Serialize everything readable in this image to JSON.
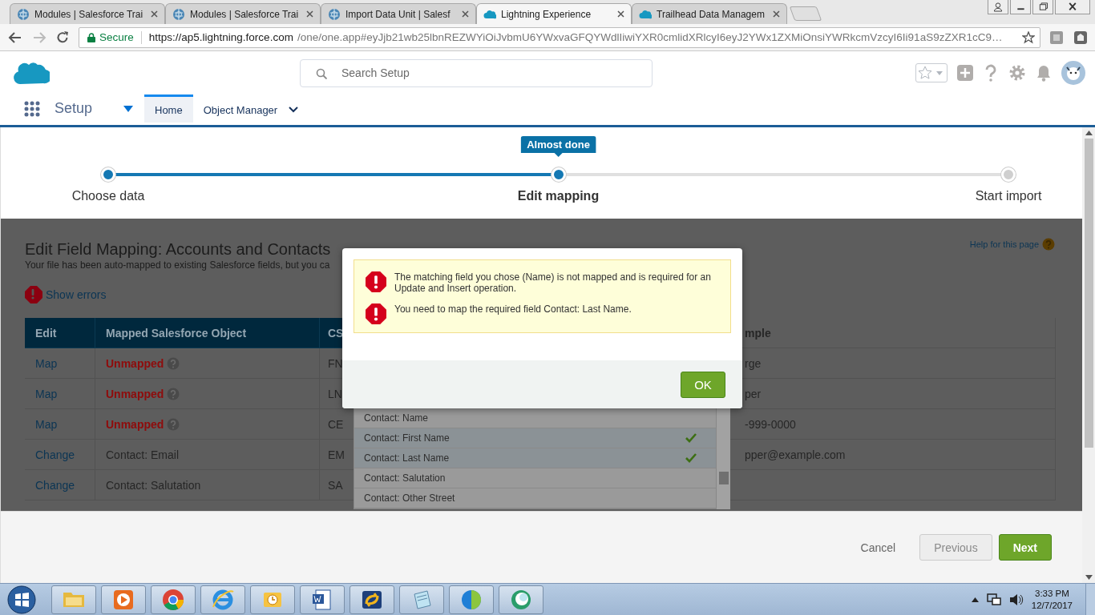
{
  "browser": {
    "tabs": [
      {
        "title": "Modules | Salesforce Trai",
        "kind": "globe",
        "selected": false
      },
      {
        "title": "Modules | Salesforce Trai",
        "kind": "globe",
        "selected": false
      },
      {
        "title": "Import Data Unit | Salesf",
        "kind": "globe",
        "selected": false
      },
      {
        "title": "Lightning Experience",
        "kind": "cloud",
        "selected": true
      },
      {
        "title": "Trailhead Data Managem",
        "kind": "cloud",
        "selected": false
      }
    ],
    "secure_label": "Secure",
    "url_host": "https://ap5.lightning.force.com",
    "url_path": "/one/one.app#eyJjb21wb25lbnREZWYiOiJvbmU6YWxvaGFQYWdlIiwiYXR0cmlidXRlcyI6eyJ2YWx1ZXMiOnsiYWRkcmVzcyI6Ii91aS9zZXR1cC9…"
  },
  "header": {
    "search_placeholder": "Search Setup"
  },
  "nav": {
    "app_name": "Setup",
    "tabs": [
      {
        "label": "Home",
        "selected": true,
        "has_menu": false
      },
      {
        "label": "Object Manager",
        "selected": false,
        "has_menu": true
      }
    ]
  },
  "progress": {
    "level": 0.5,
    "badge": "Almost done",
    "steps": [
      {
        "label": "Choose data",
        "selected": false
      },
      {
        "label": "Edit mapping",
        "selected": true
      },
      {
        "label": "Start import",
        "selected": false
      }
    ]
  },
  "mapping": {
    "title": "Edit Field Mapping: Accounts and Contacts",
    "subtitle": "Your file has been auto-mapped to existing Salesforce fields, but you ca",
    "help_link": "Help for this page",
    "show_errors": "Show errors",
    "columns": [
      "Edit",
      "Mapped Salesforce Object",
      "CS",
      "mple"
    ],
    "rows": [
      {
        "action": "Map",
        "mapped": "Unmapped",
        "unmapped": true,
        "csv": "FN",
        "example": "rge"
      },
      {
        "action": "Map",
        "mapped": "Unmapped",
        "unmapped": true,
        "csv": "LN",
        "example": "per"
      },
      {
        "action": "Map",
        "mapped": "Unmapped",
        "unmapped": true,
        "csv": "CE",
        "example": "-999-0000"
      },
      {
        "action": "Change",
        "mapped": "Contact: Email",
        "unmapped": false,
        "csv": "EM",
        "example": "pper@example.com"
      },
      {
        "action": "Change",
        "mapped": "Contact: Salutation",
        "unmapped": false,
        "csv": "SA"
      }
    ]
  },
  "field_picker": {
    "items": [
      {
        "label": "Contact: Name",
        "selected": false
      },
      {
        "label": "Contact: First Name",
        "selected": true
      },
      {
        "label": "Contact: Last Name",
        "selected": true
      },
      {
        "label": "Contact: Salutation",
        "selected": false
      },
      {
        "label": "Contact: Other Street",
        "selected": false
      }
    ]
  },
  "dialog": {
    "errors": [
      "The matching field you chose (Name) is not mapped and is required for an Update and Insert operation.",
      "You need to map the required field Contact: Last Name."
    ],
    "ok_label": "OK"
  },
  "footer": {
    "cancel": "Cancel",
    "previous": {
      "label": "Previous",
      "disabled": true
    },
    "next": "Next"
  },
  "taskbar": {
    "time": "3:33 PM",
    "date": "12/7/2017"
  }
}
